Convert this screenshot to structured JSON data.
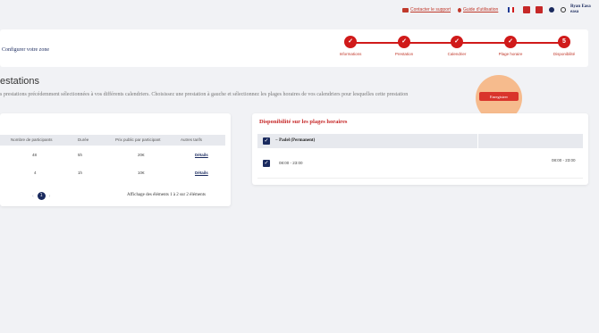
{
  "topbar": {
    "support_link": "Contacter le support",
    "guide_link": "Guide d'utilisation",
    "user_first": "Ryan Easa",
    "user_second": "easa"
  },
  "colors": {
    "accent": "#d01a1a",
    "navy": "#1a2a5e",
    "halo": "#f7b27a"
  },
  "stepper": {
    "title": "Configurer votre zone",
    "steps": [
      {
        "label": "Informations",
        "mark": "✓"
      },
      {
        "label": "Prestation",
        "mark": "✓"
      },
      {
        "label": "Calendrier",
        "mark": "✓"
      },
      {
        "label": "Plage horaire",
        "mark": "✓"
      },
      {
        "label": "Disponibilité",
        "mark": "5"
      }
    ]
  },
  "section": {
    "title": "estations",
    "description": "s prestations précédemment sélectionnées à vos différents calendriers. Choisissez une prestation à gauche et sélectionnez les plages horaires de vos calendriers pour lesquelles cette prestation"
  },
  "save_button": "Enregistrer",
  "prestations_table": {
    "columns": [
      "Nombre de participants",
      "Durée",
      "Prix public par participant",
      "Autres tarifs"
    ],
    "rows": [
      {
        "participants": "48",
        "duree": "5h",
        "prix": "20€",
        "tarifs": "Détails"
      },
      {
        "participants": "4",
        "duree": "1h",
        "prix": "10€",
        "tarifs": "Détails"
      }
    ],
    "pagination": {
      "prev": "‹",
      "page": "1",
      "next": "›",
      "info": "Affichage des éléments 1 à 2 sur 2 éléments"
    }
  },
  "availability": {
    "title": "Disponibilité sur les plages horaires",
    "group_label": "Padel (Permanent)",
    "group_toggle": "−",
    "check": "✓",
    "slot_left": "08:00 - 23:00",
    "slot_right": "08:00 - 23:00"
  }
}
